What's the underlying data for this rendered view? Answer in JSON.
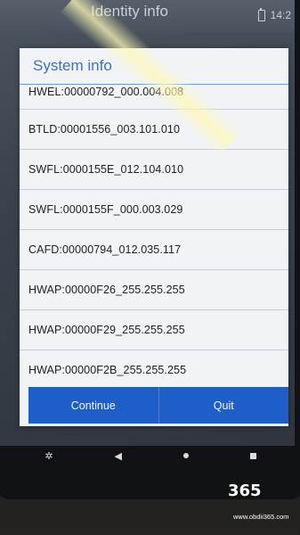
{
  "app_bar": {
    "title": "Identity info",
    "time": "14:2"
  },
  "dialog": {
    "title": "System info",
    "items": [
      "HWEL:00000792_000.004.008",
      "BTLD:00001556_003.101.010",
      "SWFL:0000155E_012.104.010",
      "SWFL:0000155F_000.003.029",
      "CAFD:00000794_012.035.117",
      "HWAP:00000F26_255.255.255",
      "HWAP:00000F29_255.255.255",
      "HWAP:00000F2B_255.255.255"
    ],
    "buttons": {
      "continue": "Continue",
      "quit": "Quit"
    }
  },
  "navigation": {
    "icons": [
      "settings-icon",
      "back-icon",
      "home-icon",
      "recents-icon"
    ]
  },
  "watermark": {
    "logo": "365",
    "url": "www.obdii365.com"
  },
  "colors": {
    "accent": "#1e5ec9",
    "title": "#3f6fc2",
    "dialog_bg": "#f1f3f6"
  }
}
